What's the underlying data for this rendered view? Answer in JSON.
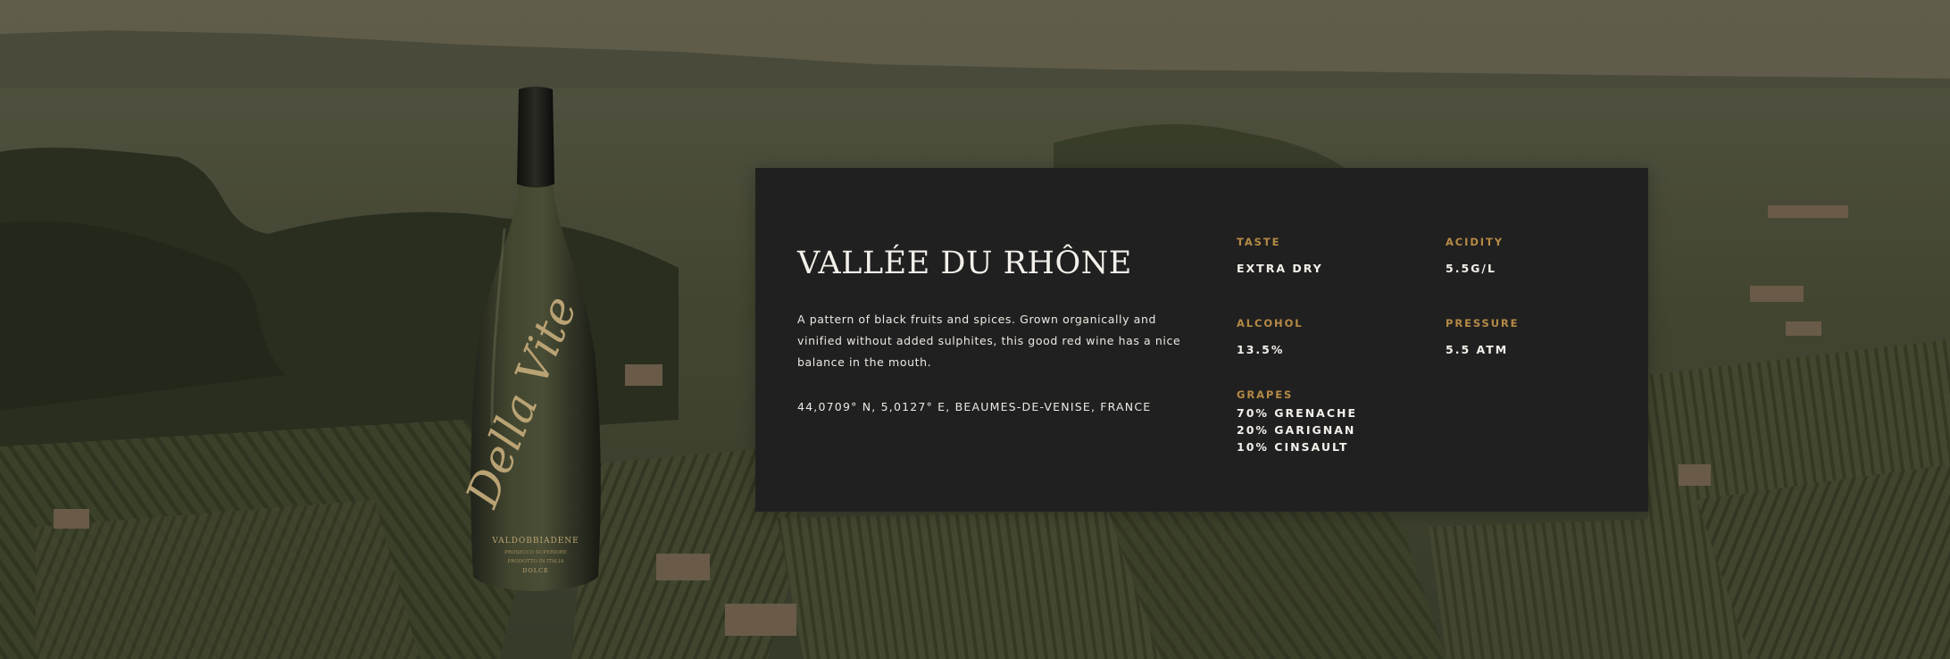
{
  "wine": {
    "region_title": "VALLÉE DU RHÔNE",
    "description": "A pattern of black fruits and spices. Grown organically and vinified without added sulphites, this good red wine has a nice balance in the mouth.",
    "location": "44,0709° N, 5,0127° E, BEAUMES-DE-VENISE, FRANCE"
  },
  "specs": {
    "taste": {
      "label": "TASTE",
      "value": "EXTRA DRY"
    },
    "acidity": {
      "label": "ACIDITY",
      "value": "5.5G/L"
    },
    "alcohol": {
      "label": "ALCOHOL",
      "value": "13.5%"
    },
    "pressure": {
      "label": "PRESSURE",
      "value": "5.5 ATM"
    },
    "grapes": {
      "label": "GRAPES",
      "items": [
        "70% GRENACHE",
        "20% GARIGNAN",
        "10% CINSAULT"
      ]
    }
  },
  "bottle": {
    "brand_script": "Della Vite",
    "label_lines": [
      "VALDOBBIADENE",
      "PROSECCO SUPERIORE",
      "PRODOTTO IN ITALIA",
      "DOLCE"
    ]
  },
  "colors": {
    "card_background": "#212020",
    "label_accent": "#b58a46",
    "text_primary": "#f3f0ea",
    "bottle_glass": "#3b3e2c"
  }
}
